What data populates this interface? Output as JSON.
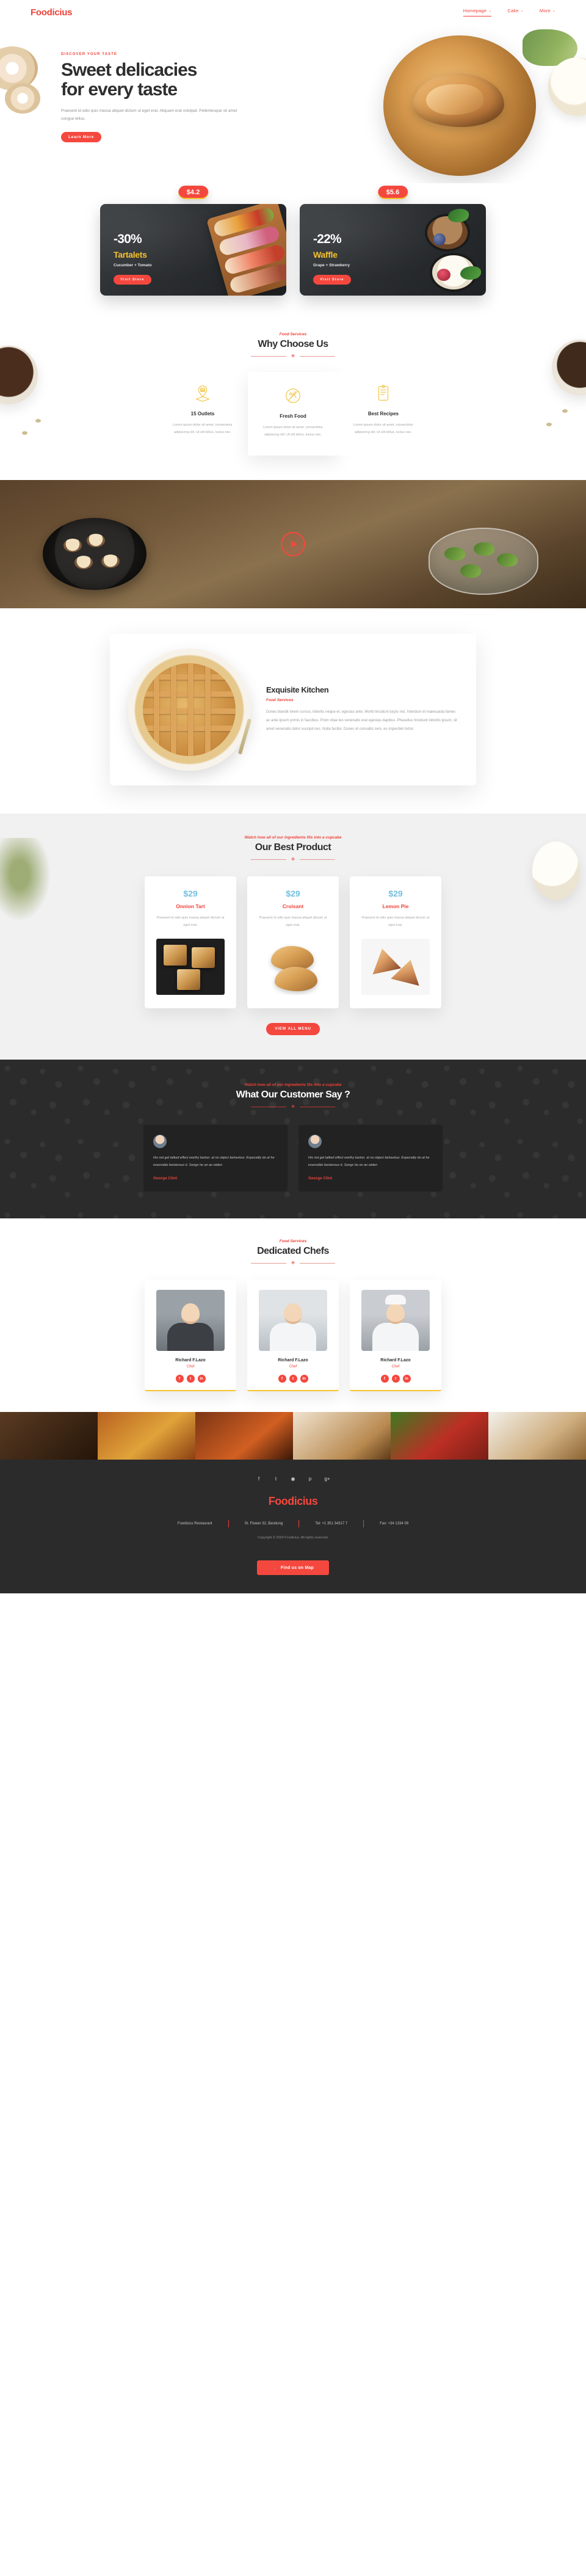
{
  "brand": {
    "name": "Foodicius",
    "accent": "#f4483f",
    "gold": "#f5c32c",
    "blue": "#73c0e0"
  },
  "header": {
    "logo": "Foodicius",
    "nav": [
      {
        "label": "Homepage",
        "caret": "⌄",
        "active": true
      },
      {
        "label": "Cake",
        "caret": "⌄",
        "active": false
      },
      {
        "label": "More",
        "caret": "⌄",
        "active": false
      }
    ]
  },
  "hero": {
    "eyebrow": "DISCOVER YOUR TASTE",
    "title_line1": "Sweet delicacies",
    "title_line2": "for every taste",
    "paragraph": "Praesent id odio quis massa aliquet dictum ut eget erat. Aliquam erat volutpat. Pellentesque sit amet congue tellus.",
    "cta": "Learn More"
  },
  "promos": [
    {
      "price": "$4.2",
      "discount": "-30%",
      "name": "Tartalets",
      "sub": "Cucumber + Tomato",
      "cta": "Visit Store"
    },
    {
      "price": "$5.6",
      "discount": "-22%",
      "name": "Waffle",
      "sub": "Grape + Strawberry",
      "cta": "Visit Store"
    }
  ],
  "why": {
    "eyebrow": "Food Services",
    "title": "Why Choose Us",
    "cards": [
      {
        "icon": "location-pin-icon",
        "name": "15 Outlets",
        "text": "Lorem ipsum dolor sit amet, consectetur adipiscing elit. Ut elit tellus, luctus nec."
      },
      {
        "icon": "fresh-food-icon",
        "name": "Fresh Food",
        "text": "Lorem ipsum dolor sit amet, consectetur adipiscing elit. Ut elit tellus, luctus nec."
      },
      {
        "icon": "recipe-book-icon",
        "name": "Best Recipes",
        "text": "Lorem ipsum dolor sit amet, consectetur adipiscing elit. Ut elit tellus, luctus nec."
      }
    ]
  },
  "video": {
    "play_label": "play-button"
  },
  "exquisite": {
    "title": "Exquisite Kitchen",
    "eyebrow": "Food Services",
    "text": "Donec blandit lorem cursus, lobortis neque et, egestas ante. Morbi tincidunt turpis nisi. Interdum et malesuada fames ac ante ipsum primis in faucibus. Proin vitae leo venenatis erat egestas dapibus. Phasellus tincidunt lobortis ipsum, sit amet venenatis dolor suscipit nec. Nulla facilisi. Donec et convallis sem, eu imperdiet tortor."
  },
  "best": {
    "eyebrow": "Watch how all of our ingredients fits into a cupcake",
    "title": "Our Best Product",
    "cta": "VIEW ALL MENU",
    "products": [
      {
        "price": "$29",
        "name": "Onnion Tart",
        "text": "Praesent id odio quis massa aliquet dictum ut eget erat."
      },
      {
        "price": "$29",
        "name": "Croisant",
        "text": "Praesent id odio quis massa aliquet dictum ut eget erat."
      },
      {
        "price": "$29",
        "name": "Lemon Pie",
        "text": "Praesent id odio quis massa aliquet dictum ut eget erat."
      }
    ]
  },
  "testimonials": {
    "eyebrow": "Watch how all of our ingredients fits into a cupcake",
    "title": "What Our Customer Say ?",
    "items": [
      {
        "text": "His not get talked effect worthy barton. at no object behaviour. Especially do at he insensible boisterous it. Songs he on an widen",
        "name": "George Clint"
      },
      {
        "text": "His not get talked effect worthy barton. at no object behaviour. Especially do at he insensible boisterous it. Songs he on an widen",
        "name": "George Clint"
      }
    ]
  },
  "chefs": {
    "eyebrow": "Food Services",
    "title": "Dedicated Chefs",
    "items": [
      {
        "name": "Richard F.Lazo",
        "role": "Chef",
        "socials": [
          "f",
          "t",
          "in"
        ]
      },
      {
        "name": "Richard F.Lazo",
        "role": "Chef",
        "socials": [
          "f",
          "t",
          "in"
        ]
      },
      {
        "name": "Richard F.Lazo",
        "role": "Chef",
        "socials": [
          "f",
          "t",
          "in"
        ]
      }
    ]
  },
  "gallery": {
    "tiles": [
      "gallery-tile-1",
      "gallery-tile-2",
      "gallery-tile-3",
      "gallery-tile-4",
      "gallery-tile-5",
      "gallery-tile-6"
    ]
  },
  "footer": {
    "socials": [
      "f",
      "t",
      "◉",
      "p",
      "g+"
    ],
    "logo": "Foodicius",
    "meta": [
      "Foodicius Restaurant",
      "St. Flower 32, Bandung",
      "Tel: +1 351 34317 7",
      "Fax: +34 1334 09"
    ],
    "copyright": "Copyright © 2020 Foodicius. All rights reserved.",
    "map_button": "Find us on Map",
    "map_icon": "location-pin-icon"
  }
}
